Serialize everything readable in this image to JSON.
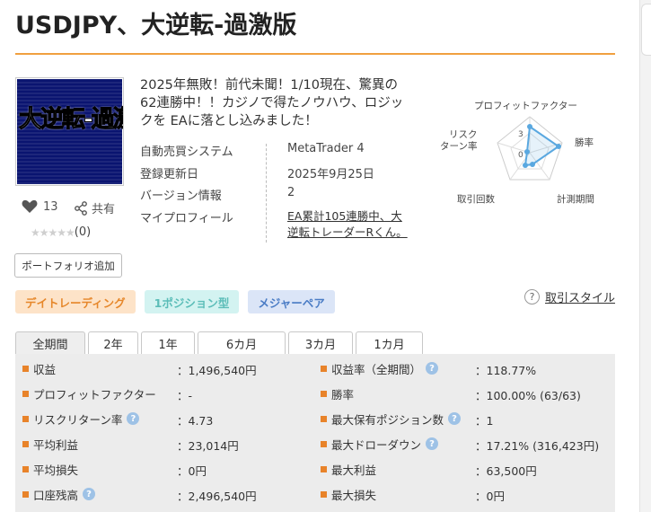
{
  "title": "USDJPY、大逆転-過激版",
  "thumbnail_text": "大逆転-過激版",
  "likes": "13",
  "share_label": "共有",
  "rating_count": "(0)",
  "portfolio_button": "ポートフォリオ追加",
  "description": "2025年無敗！前代未聞！1/10現在、驚異の62連勝中！！カジノで得たノウハウ、ロジックを EAに落とし込みました！",
  "info": [
    {
      "label": "自動売買システム",
      "value": "MetaTrader 4"
    },
    {
      "label": "登録更新日",
      "value": "2025年9月25日"
    },
    {
      "label": "バージョン情報",
      "value": "2"
    },
    {
      "label": "マイプロフィール",
      "value": "EA累計105連勝中、大逆転トレーダーRくん。"
    }
  ],
  "radar": {
    "labels": {
      "pf": "プロフィットファクター",
      "win": "勝率",
      "period": "計測期間",
      "trades": "取引回数",
      "risk": "リスク\nターン率"
    },
    "scale_max": "3",
    "scale_min": "0",
    "accent": "#5aa8e0"
  },
  "tags": [
    "デイトレーディング",
    "1ポジション型",
    "メジャーペア"
  ],
  "style_link": "取引スタイル",
  "tabs": [
    "全期間",
    "2年",
    "1年",
    "6カ月",
    "3カ月",
    "1カ月"
  ],
  "stats_left": [
    {
      "label": "収益",
      "value": "：1,496,540円",
      "help": false
    },
    {
      "label": "プロフィットファクター",
      "value": "：-",
      "help": false
    },
    {
      "label": "リスクリターン率",
      "value": "：4.73",
      "help": true
    },
    {
      "label": "平均利益",
      "value": "：23,014円",
      "help": false
    },
    {
      "label": "平均損失",
      "value": "：0円",
      "help": false
    },
    {
      "label": "口座残高",
      "value": "：2,496,540円",
      "help": true
    }
  ],
  "stats_right": [
    {
      "label": "収益率（全期間）",
      "value": "：118.77%",
      "help": true
    },
    {
      "label": "勝率",
      "value": "：100.00% (63/63)",
      "help": false
    },
    {
      "label": "最大保有ポジション数",
      "value": "：1",
      "help": true
    },
    {
      "label": "最大ドローダウン",
      "value": "：17.21% (316,423円)",
      "help": true
    },
    {
      "label": "最大利益",
      "value": "：63,500円",
      "help": false
    },
    {
      "label": "最大損失",
      "value": "：0円",
      "help": false
    }
  ],
  "colors": {
    "accent_orange": "#e8832a",
    "rule": "#f0a040"
  }
}
